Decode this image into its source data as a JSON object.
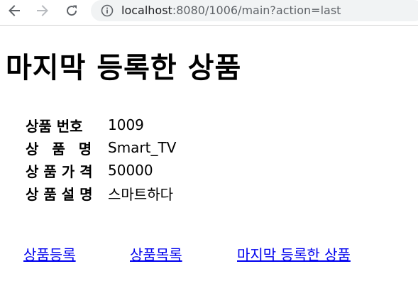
{
  "browser": {
    "url_host": "localhost",
    "url_path": ":8080/1006/main?action=last"
  },
  "page": {
    "title": "마지막 등록한 상품"
  },
  "product": {
    "rows": [
      {
        "label": "상품 번호",
        "value": "1009"
      },
      {
        "label": "상 품 명",
        "value": "Smart_TV"
      },
      {
        "label": "상 품 가 격",
        "value": "50000"
      },
      {
        "label": "상 품 설 명",
        "value": "스마트하다"
      }
    ]
  },
  "links": {
    "register": "상품등록",
    "list": "상품목록",
    "last": "마지막 등록한 상품"
  },
  "colors": {
    "link": "#0000ee",
    "omnibox_bg": "#f1f3f4",
    "icon_gray": "#5f6368"
  },
  "icons": {
    "back": "arrow-left",
    "forward": "arrow-right",
    "reload": "reload",
    "info": "info-circle"
  }
}
